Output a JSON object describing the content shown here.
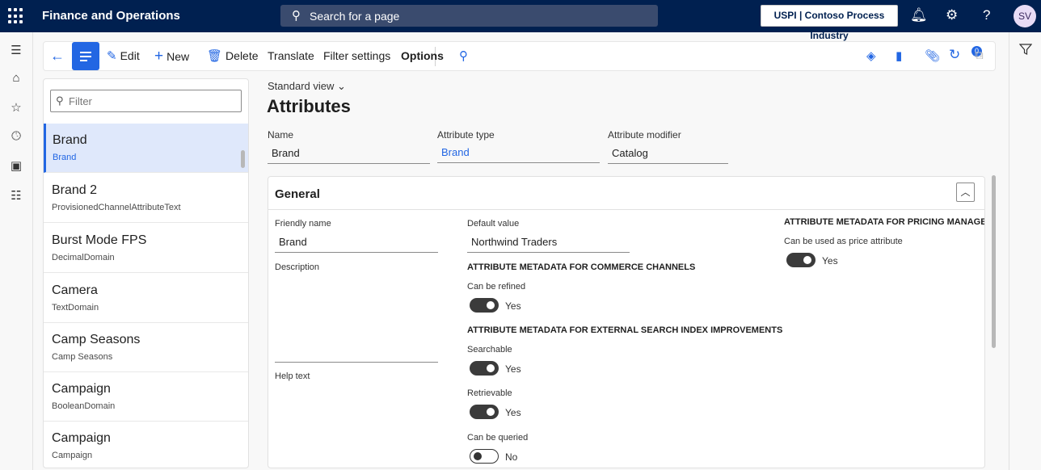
{
  "topbar": {
    "app_title": "Finance and Operations",
    "search_placeholder": "Search for a page",
    "company": "USPI | Contoso Process Industry",
    "user_initials": "SV"
  },
  "actions": {
    "edit": "Edit",
    "new": "New",
    "delete": "Delete",
    "translate": "Translate",
    "filter_settings": "Filter settings",
    "options": "Options",
    "attachments_count": "0"
  },
  "list": {
    "filter_placeholder": "Filter",
    "items": [
      {
        "title": "Brand",
        "subtitle": "Brand"
      },
      {
        "title": "Brand 2",
        "subtitle": "ProvisionedChannelAttributeText"
      },
      {
        "title": "Burst Mode FPS",
        "subtitle": "DecimalDomain"
      },
      {
        "title": "Camera",
        "subtitle": "TextDomain"
      },
      {
        "title": "Camp Seasons",
        "subtitle": "Camp Seasons"
      },
      {
        "title": "Campaign",
        "subtitle": "BooleanDomain"
      },
      {
        "title": "Campaign",
        "subtitle": "Campaign"
      }
    ]
  },
  "main": {
    "view": "Standard view",
    "title": "Attributes",
    "header_fields": {
      "name_label": "Name",
      "name_value": "Brand",
      "type_label": "Attribute type",
      "type_value": "Brand",
      "modifier_label": "Attribute modifier",
      "modifier_value": "Catalog"
    },
    "general": {
      "title": "General",
      "friendly_name_label": "Friendly name",
      "friendly_name_value": "Brand",
      "description_label": "Description",
      "help_text_label": "Help text",
      "default_value_label": "Default value",
      "default_value": "Northwind Traders",
      "commerce_heading": "ATTRIBUTE METADATA FOR COMMERCE CHANNELS",
      "can_be_refined_label": "Can be refined",
      "can_be_refined_value": "Yes",
      "search_heading": "ATTRIBUTE METADATA FOR EXTERNAL SEARCH INDEX IMPROVEMENTS",
      "searchable_label": "Searchable",
      "searchable_value": "Yes",
      "retrievable_label": "Retrievable",
      "retrievable_value": "Yes",
      "queried_label": "Can be queried",
      "queried_value": "No",
      "pricing_heading": "ATTRIBUTE METADATA FOR PRICING MANAGEM",
      "price_attr_label": "Can be used as price attribute",
      "price_attr_value": "Yes"
    }
  }
}
